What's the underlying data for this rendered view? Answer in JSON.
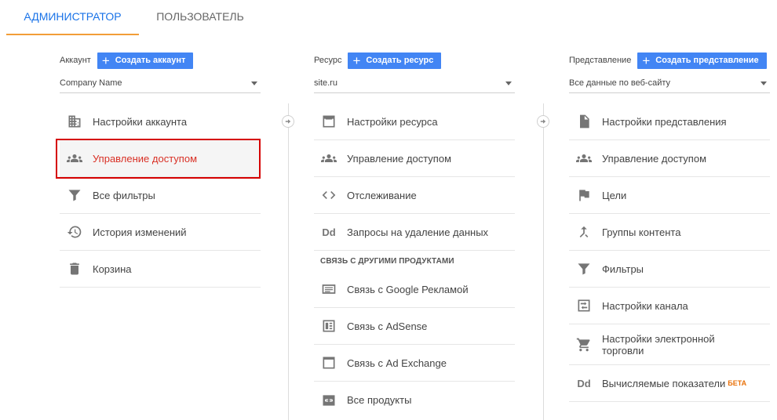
{
  "tabs": {
    "admin": "АДМИНИСТРАТОР",
    "user": "ПОЛЬЗОВАТЕЛЬ"
  },
  "account": {
    "label": "Аккаунт",
    "create_button": "Создать аккаунт",
    "selected": "Company Name",
    "items": [
      {
        "label": "Настройки аккаунта",
        "icon": "building-icon"
      },
      {
        "label": "Управление доступом",
        "icon": "people-icon"
      },
      {
        "label": "Все фильтры",
        "icon": "filter-icon"
      },
      {
        "label": "История изменений",
        "icon": "history-icon"
      },
      {
        "label": "Корзина",
        "icon": "trash-icon"
      }
    ]
  },
  "property": {
    "label": "Ресурс",
    "create_button": "Создать ресурс",
    "selected": "site.ru",
    "items": [
      {
        "label": "Настройки ресурса",
        "icon": "window-icon"
      },
      {
        "label": "Управление доступом",
        "icon": "people-icon"
      },
      {
        "label": "Отслеживание",
        "icon": "code-icon"
      },
      {
        "label": "Запросы на удаление данных",
        "icon": "dd-icon",
        "icon_text": "Dd"
      }
    ],
    "section_title": "СВЯЗЬ С ДРУГИМИ ПРОДУКТАМИ",
    "linked": [
      {
        "label": "Связь с Google Рекламой",
        "icon": "ads-icon"
      },
      {
        "label": "Связь с AdSense",
        "icon": "adsense-icon"
      },
      {
        "label": "Связь с Ad Exchange",
        "icon": "adexchange-icon"
      },
      {
        "label": "Все продукты",
        "icon": "link-icon"
      }
    ]
  },
  "view": {
    "label": "Представление",
    "create_button": "Создать представление",
    "selected": "Все данные по веб-сайту",
    "items": [
      {
        "label": "Настройки представления",
        "icon": "document-icon"
      },
      {
        "label": "Управление доступом",
        "icon": "people-icon"
      },
      {
        "label": "Цели",
        "icon": "flag-icon"
      },
      {
        "label": "Группы контента",
        "icon": "merge-icon"
      },
      {
        "label": "Фильтры",
        "icon": "filter-icon"
      },
      {
        "label": "Настройки канала",
        "icon": "channel-icon"
      },
      {
        "label": "Настройки электронной торговли",
        "icon": "cart-icon"
      },
      {
        "label": "Вычисляемые показатели",
        "icon": "dd-icon",
        "icon_text": "Dd",
        "badge": "БЕТА"
      }
    ]
  },
  "colors": {
    "accent": "#4285f4",
    "tab_active": "#1a73e8",
    "tab_underline": "#f29d38",
    "highlight_border": "#d50000",
    "highlight_text": "#d93025"
  }
}
